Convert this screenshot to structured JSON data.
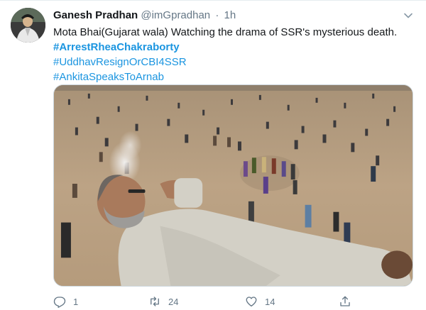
{
  "tweet": {
    "author_name": "Ganesh Pradhan",
    "handle": "@imGpradhan",
    "separator": "·",
    "time": "1h",
    "text": "Mota Bhai(Gujarat wala) Watching the drama of SSR's mysterious death.",
    "hashtags": [
      "#ArrestRheaChakraborty",
      "#UddhavResignOrCBI4SSR",
      "#AnkitaSpeaksToArnab"
    ]
  },
  "actions": {
    "reply_icon": "reply-icon",
    "reply_count": "1",
    "retweet_icon": "retweet-icon",
    "retweet_count": "24",
    "like_icon": "heart-icon",
    "like_count": "14",
    "share_icon": "share-icon"
  },
  "colors": {
    "link": "#1b95e0",
    "muted": "#657786",
    "text": "#14171a"
  }
}
